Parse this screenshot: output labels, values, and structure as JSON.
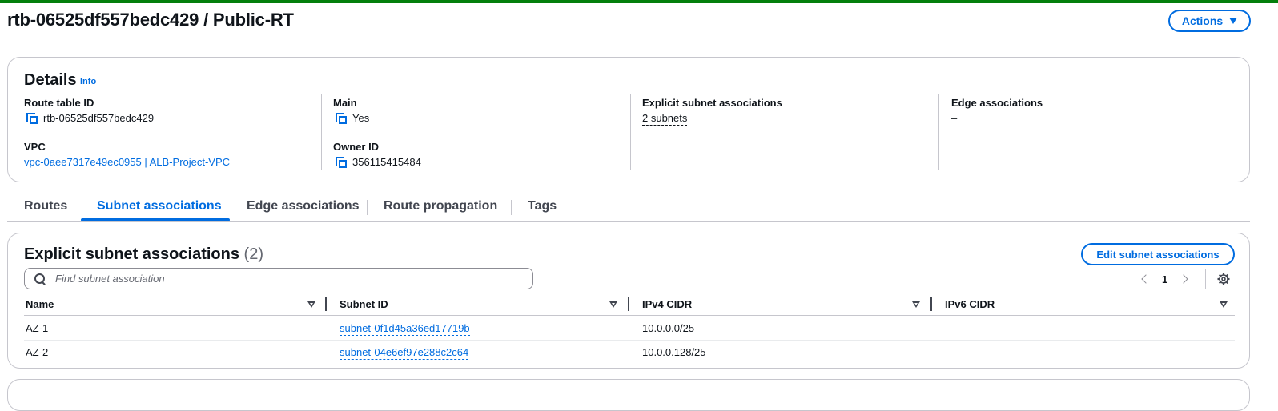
{
  "header": {
    "title": "rtb-06525df557bedc429 / Public-RT",
    "actions_label": "Actions"
  },
  "details": {
    "title": "Details",
    "info_label": "Info",
    "route_table_id_label": "Route table ID",
    "route_table_id": "rtb-06525df557bedc429",
    "vpc_label": "VPC",
    "vpc_value": "vpc-0aee7317e49ec0955 | ALB-Project-VPC",
    "main_label": "Main",
    "main_value": "Yes",
    "owner_id_label": "Owner ID",
    "owner_id": "356115415484",
    "explicit_label": "Explicit subnet associations",
    "explicit_value": "2 subnets",
    "edge_label": "Edge associations",
    "edge_value": "–"
  },
  "tabs": [
    {
      "label": "Routes"
    },
    {
      "label": "Subnet associations"
    },
    {
      "label": "Edge associations"
    },
    {
      "label": "Route propagation"
    },
    {
      "label": "Tags"
    }
  ],
  "subnets": {
    "title": "Explicit subnet associations",
    "count": "(2)",
    "edit_label": "Edit subnet associations",
    "search_placeholder": "Find subnet association",
    "page": "1",
    "columns": [
      "Name",
      "Subnet ID",
      "IPv4 CIDR",
      "IPv6 CIDR"
    ],
    "rows": [
      {
        "name": "AZ-1",
        "subnet_id": "subnet-0f1d45a36ed17719b",
        "ipv4": "10.0.0.0/25",
        "ipv6": "–"
      },
      {
        "name": "AZ-2",
        "subnet_id": "subnet-04e6ef97e288c2c64",
        "ipv4": "10.0.0.128/25",
        "ipv6": "–"
      }
    ]
  },
  "colors": {
    "accent": "#006ce0",
    "success_bar": "#037f0c",
    "border": "#c6c6cd"
  }
}
